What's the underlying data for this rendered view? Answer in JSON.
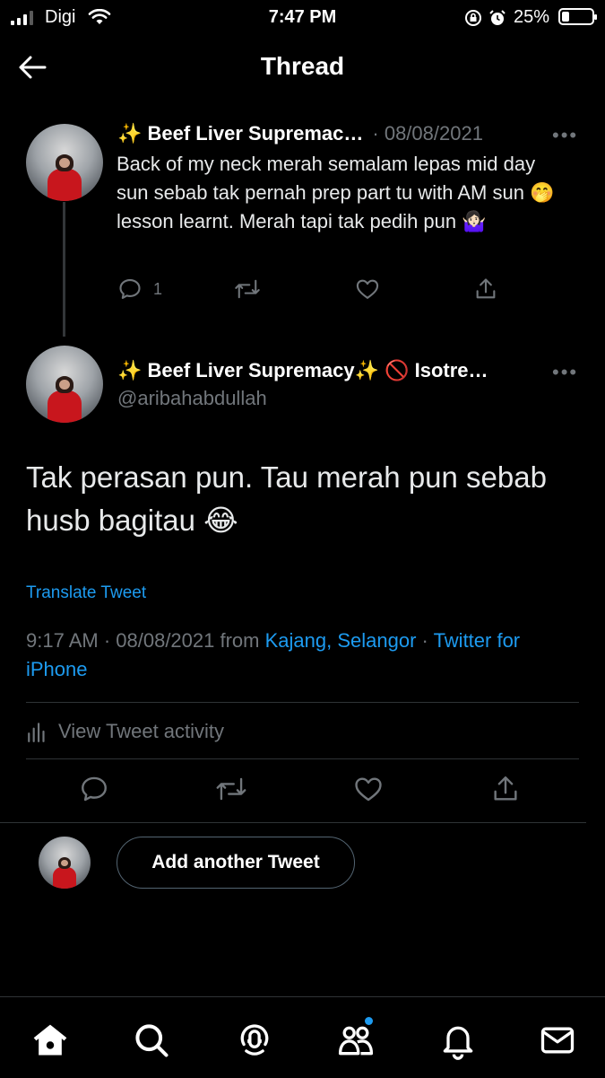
{
  "status_bar": {
    "carrier": "Digi",
    "time": "7:47 PM",
    "battery": "25%",
    "battery_level": 0.25
  },
  "header": {
    "title": "Thread"
  },
  "parent_tweet": {
    "display_name": "✨ Beef Liver Supremac…",
    "date": "· 08/08/2021",
    "text": "Back of my neck merah semalam lepas mid day sun sebab tak pernah prep part tu with AM sun 🤭 lesson learnt. Merah tapi tak pedih pun 🤷🏻‍♀️",
    "reply_count": "1"
  },
  "main_tweet": {
    "display_name": "✨ Beef Liver Supremacy✨  🚫 Isotre…",
    "handle": "@aribahabdullah",
    "text": "Tak perasan pun. Tau merah pun sebab husb bagitau 😂",
    "translate": "Translate Tweet",
    "time_date": "9:17 AM · 08/08/2021 from ",
    "location": "Kajang, Selangor",
    "separator": " · ",
    "source": "Twitter for iPhone",
    "activity": "View Tweet activity"
  },
  "composer": {
    "button": "Add another Tweet"
  },
  "colors": {
    "accent": "#1d9bf0",
    "background": "#000000",
    "muted": "#71767b"
  },
  "tab_bar": {
    "items": [
      "home-icon",
      "search-icon",
      "spaces-icon",
      "communities-icon",
      "notifications-icon",
      "messages-icon"
    ]
  }
}
